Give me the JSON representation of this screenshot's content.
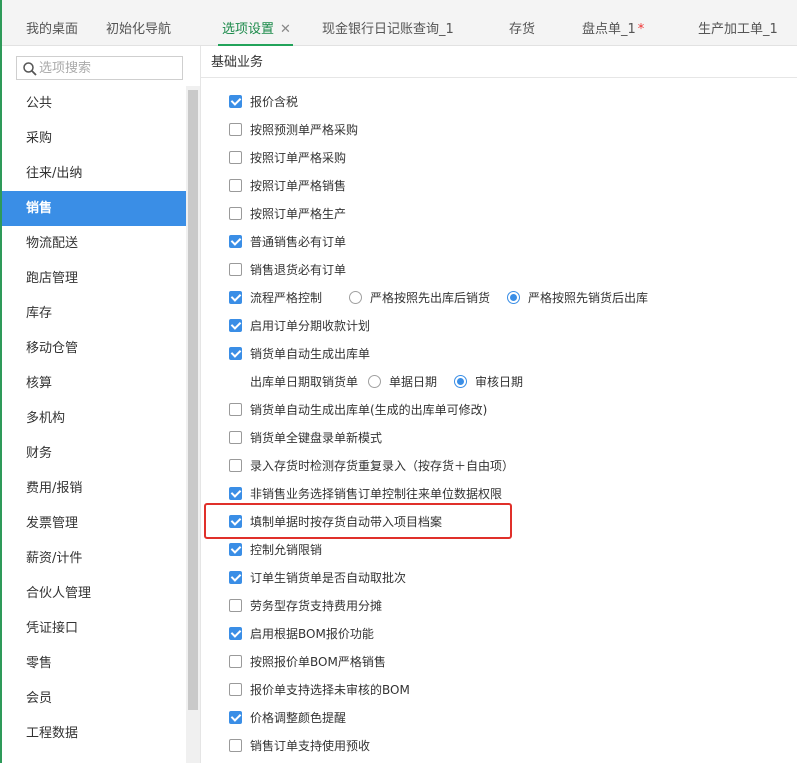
{
  "tabs": [
    {
      "label": "我的桌面",
      "active": false
    },
    {
      "label": "初始化导航",
      "active": false
    },
    {
      "label": "选项设置",
      "active": true,
      "close": "✕"
    },
    {
      "label": "现金银行日记账查询_1",
      "active": false
    },
    {
      "label": "存货",
      "active": false
    },
    {
      "label": "盘点单_1",
      "active": false,
      "mark": "*"
    },
    {
      "label": "生产加工单_1",
      "active": false
    }
  ],
  "sidebar": {
    "search_placeholder": "选项搜索",
    "items": [
      "公共",
      "采购",
      "往来/出纳",
      "销售",
      "物流配送",
      "跑店管理",
      "库存",
      "移动仓管",
      "核算",
      "多机构",
      "财务",
      "费用/报销",
      "发票管理",
      "薪资/计件",
      "合伙人管理",
      "凭证接口",
      "零售",
      "会员",
      "工程数据"
    ],
    "active_index": 3
  },
  "main": {
    "section_title": "基础业务",
    "options": [
      {
        "label": "报价含税",
        "checked": true
      },
      {
        "label": "按照预测单严格采购",
        "checked": false
      },
      {
        "label": "按照订单严格采购",
        "checked": false
      },
      {
        "label": "按照订单严格销售",
        "checked": false
      },
      {
        "label": "按照订单严格生产",
        "checked": false
      },
      {
        "label": "普通销售必有订单",
        "checked": true
      },
      {
        "label": "销售退货必有订单",
        "checked": false
      },
      {
        "label": "流程严格控制",
        "checked": true
      },
      {
        "label": "启用订单分期收款计划",
        "checked": true
      },
      {
        "label": "销货单自动生成出库单",
        "checked": true
      },
      {
        "label": "出库单日期取销货单"
      },
      {
        "label": "销货单自动生成出库单(生成的出库单可修改)",
        "checked": false
      },
      {
        "label": "销货单全键盘录单新模式",
        "checked": false
      },
      {
        "label": "录入存货时检测存货重复录入（按存货＋自由项）",
        "checked": false
      },
      {
        "label": "非销售业务选择销售订单控制往来单位数据权限",
        "checked": true
      },
      {
        "label": "填制单据时按存货自动带入项目档案",
        "checked": true
      },
      {
        "label": "控制允销限销",
        "checked": true
      },
      {
        "label": "订单生销货单是否自动取批次",
        "checked": true
      },
      {
        "label": "劳务型存货支持费用分摊",
        "checked": false
      },
      {
        "label": "启用根据BOM报价功能",
        "checked": true
      },
      {
        "label": "按照报价单BOM严格销售",
        "checked": false
      },
      {
        "label": "报价单支持选择未审核的BOM",
        "checked": false
      },
      {
        "label": "价格调整颜色提醒",
        "checked": true
      },
      {
        "label": "销售订单支持使用预收",
        "checked": false
      }
    ],
    "flow_radios": [
      {
        "label": "严格按照先出库后销货",
        "checked": false
      },
      {
        "label": "严格按照先销货后出库",
        "checked": true
      }
    ],
    "date_radios": [
      {
        "label": "单据日期",
        "checked": false
      },
      {
        "label": "审核日期",
        "checked": true
      }
    ]
  },
  "colors": {
    "accent": "#3a8ee6",
    "active_tab": "#1b8a4a",
    "highlight": "#e0302a"
  }
}
